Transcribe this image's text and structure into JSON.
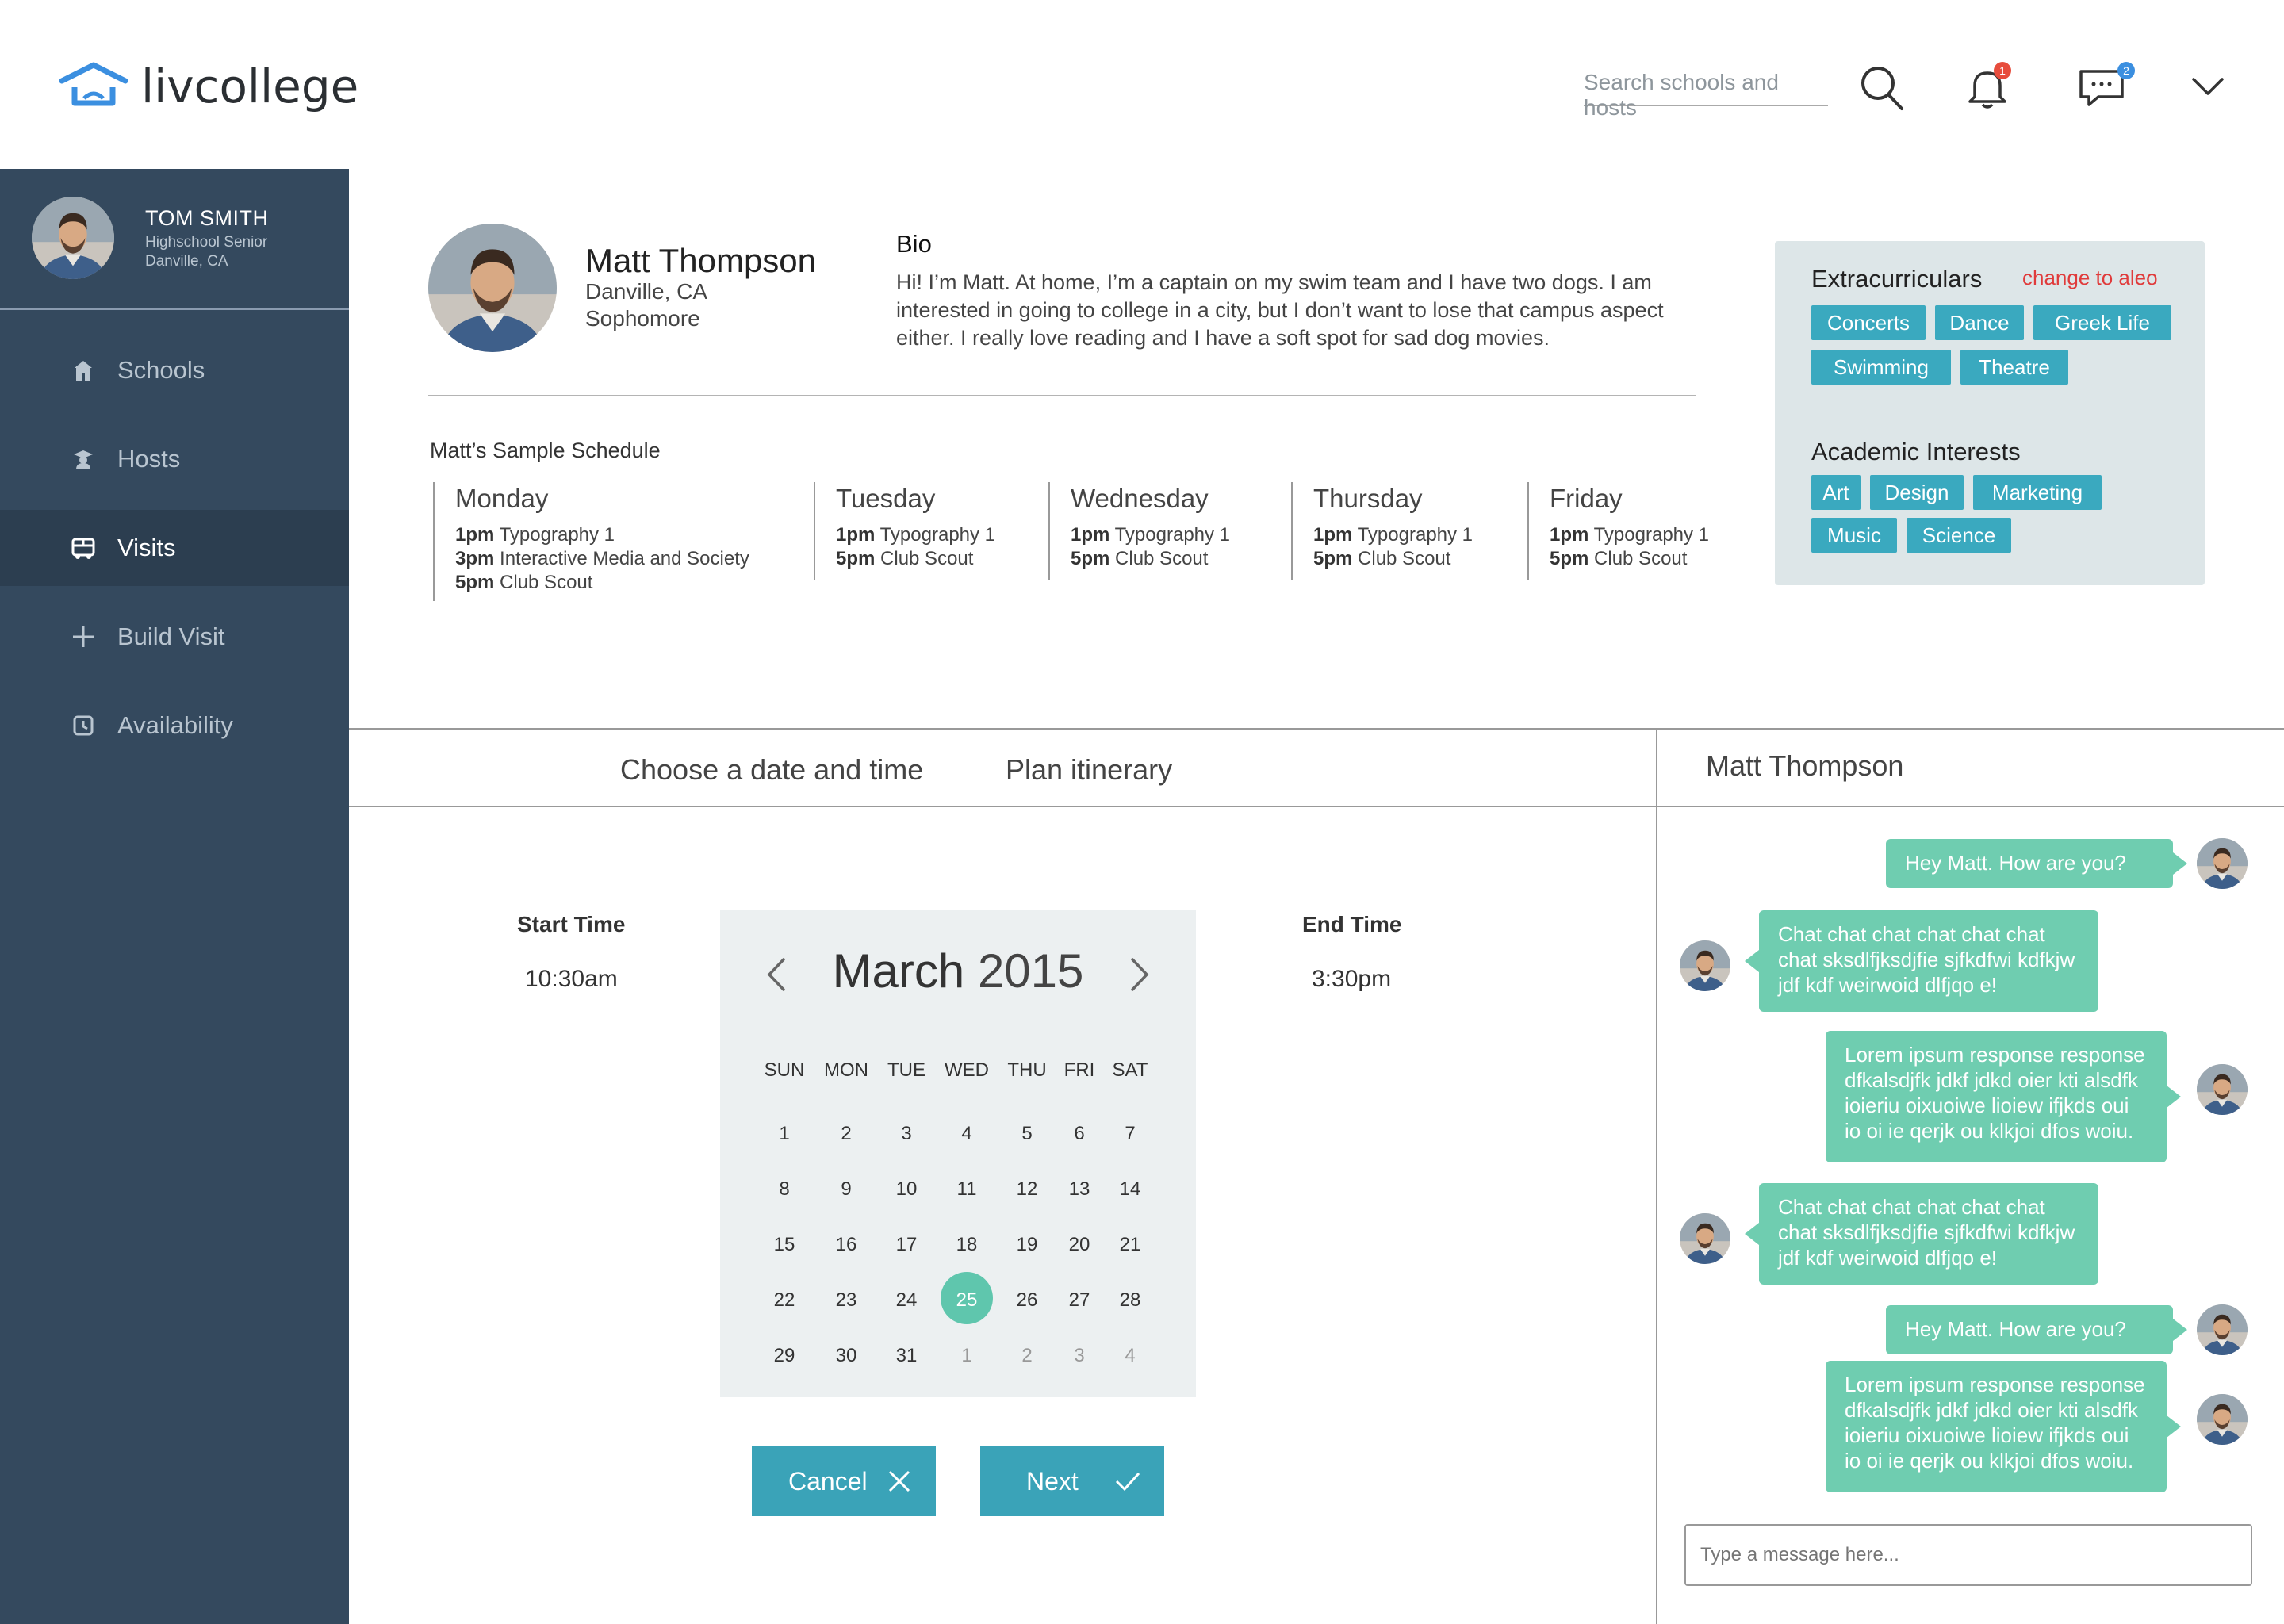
{
  "app": {
    "logo_text": "livcollege"
  },
  "header": {
    "search_placeholder": "Search schools and hosts",
    "notifications_count": "1",
    "messages_count": "2",
    "colors": {
      "notification_badge": "#e74c3c",
      "message_badge": "#3b8fe0"
    }
  },
  "user": {
    "name": "TOM SMITH",
    "role": "Highschool Senior",
    "location": "Danville, CA"
  },
  "sidebar": {
    "items": [
      {
        "label": "Schools",
        "icon": "building-icon",
        "active": false
      },
      {
        "label": "Hosts",
        "icon": "host-icon",
        "active": false
      },
      {
        "label": "Visits",
        "icon": "bus-icon",
        "active": true
      },
      {
        "label": "Build Visit",
        "icon": "plus-icon",
        "active": false
      },
      {
        "label": "Availability",
        "icon": "clock-icon",
        "active": false
      }
    ]
  },
  "host": {
    "name": "Matt Thompson",
    "location": "Danville, CA",
    "year": "Sophomore",
    "bio_title": "Bio",
    "bio": "Hi! I’m Matt. At home, I’m a captain on my swim team and I have two dogs. I am interested in going to college in a city, but I don’t want to lose that campus aspect either. I really love reading and I have a soft spot for sad dog movies."
  },
  "schedule": {
    "title": "Matt’s Sample Schedule",
    "days": [
      {
        "day": "Monday",
        "classes": [
          {
            "time": "1pm",
            "name": "Typography 1"
          },
          {
            "time": "3pm",
            "name": "Interactive Media and Society"
          },
          {
            "time": "5pm",
            "name": "Club Scout"
          }
        ]
      },
      {
        "day": "Tuesday",
        "classes": [
          {
            "time": "1pm",
            "name": "Typography 1"
          },
          {
            "time": "5pm",
            "name": "Club Scout"
          }
        ]
      },
      {
        "day": "Wednesday",
        "classes": [
          {
            "time": "1pm",
            "name": "Typography 1"
          },
          {
            "time": "5pm",
            "name": "Club Scout"
          }
        ]
      },
      {
        "day": "Thursday",
        "classes": [
          {
            "time": "1pm",
            "name": "Typography 1"
          },
          {
            "time": "5pm",
            "name": "Club Scout"
          }
        ]
      },
      {
        "day": "Friday",
        "classes": [
          {
            "time": "1pm",
            "name": "Typography 1"
          },
          {
            "time": "5pm",
            "name": "Club Scout"
          }
        ]
      }
    ]
  },
  "interests": {
    "extracurriculars_title": "Extracurriculars",
    "change_link": "change to aleo",
    "extracurriculars": [
      "Concerts",
      "Dance",
      "Greek Life",
      "Swimming",
      "Theatre"
    ],
    "academic_title": "Academic Interests",
    "academic": [
      "Art",
      "Design",
      "Marketing",
      "Music",
      "Science"
    ],
    "colors": {
      "card_bg": "#dde6e8",
      "tag_bg": "#3aa9bf",
      "link": "#e03b3b"
    }
  },
  "planner": {
    "tabs": [
      "Choose a date and time",
      "Plan itinerary"
    ],
    "start_label": "Start Time",
    "start_value": "10:30am",
    "end_label": "End Time",
    "end_value": "3:30pm",
    "cancel_label": "Cancel",
    "next_label": "Next"
  },
  "calendar": {
    "month": "March",
    "year": "2015",
    "weekdays": [
      "SUN",
      "MON",
      "TUE",
      "WED",
      "THU",
      "FRI",
      "SAT"
    ],
    "weeks": [
      [
        "1",
        "2",
        "3",
        "4",
        "5",
        "6",
        "7"
      ],
      [
        "8",
        "9",
        "10",
        "11",
        "12",
        "13",
        "14"
      ],
      [
        "15",
        "16",
        "17",
        "18",
        "19",
        "20",
        "21"
      ],
      [
        "22",
        "23",
        "24",
        "25",
        "26",
        "27",
        "28"
      ],
      [
        "29",
        "30",
        "31",
        "1",
        "2",
        "3",
        "4"
      ]
    ],
    "selected": "25",
    "selected_color": "#5fc6ad"
  },
  "chat": {
    "contact": "Matt Thompson",
    "messages": [
      {
        "from": "me",
        "text": "Hey Matt. How are you?"
      },
      {
        "from": "them",
        "text": "Chat chat chat chat chat chat chat sksdlfjksdjfie sjfkdfwi kdfkjw jdf kdf weirwoid dlfjqo e!"
      },
      {
        "from": "me",
        "text": "Lorem ipsum response response dfkalsdjfk jdkf jdkd oier kti alsdfk ioieriu oixuoiwe lioiew ifjkds oui io oi ie qerjk ou klkjoi dfos woiu."
      },
      {
        "from": "them",
        "text": "Chat chat chat chat chat chat chat sksdlfjksdjfie sjfkdfwi kdfkjw jdf kdf weirwoid dlfjqo e!"
      },
      {
        "from": "me",
        "text": "Hey Matt. How are you?"
      },
      {
        "from": "me",
        "text": "Lorem ipsum response response dfkalsdjfk jdkf jdkd oier kti alsdfk ioieriu oixuoiwe lioiew ifjkds oui io oi ie qerjk ou klkjoi dfos woiu."
      }
    ],
    "input_placeholder": "Type a message here...",
    "bubble_color": "#6fcdb0"
  }
}
